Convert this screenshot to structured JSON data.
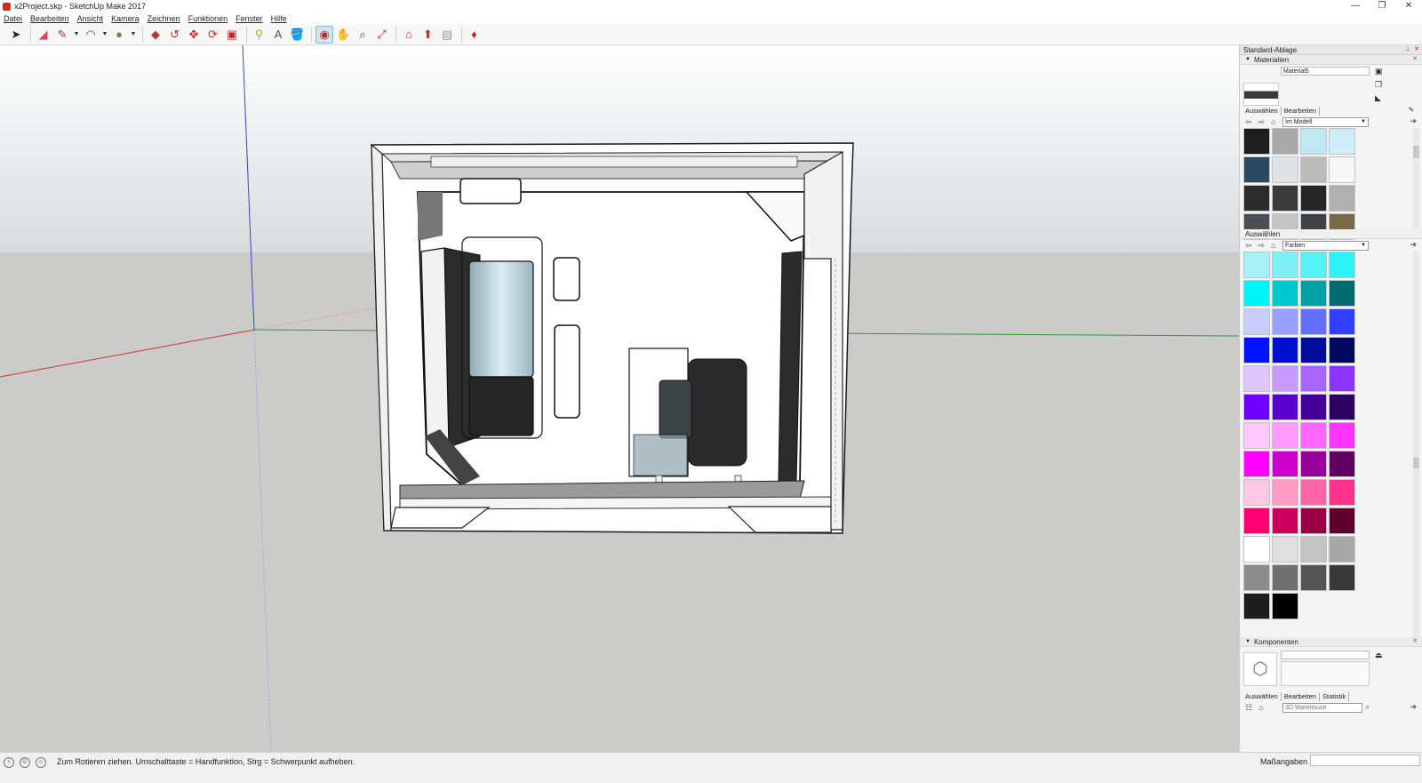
{
  "window": {
    "title": "x2Project.skp - SketchUp Make 2017",
    "controls": [
      "—",
      "❐",
      "✕"
    ]
  },
  "menu": [
    "Datei",
    "Bearbeiten",
    "Ansicht",
    "Kamera",
    "Zeichnen",
    "Funktionen",
    "Fenster",
    "Hilfe"
  ],
  "toolbar": {
    "tools": [
      {
        "name": "select-tool",
        "icon": "➤",
        "color": "#222"
      },
      {
        "name": "eraser-tool",
        "icon": "◢",
        "color": "#d9475a"
      },
      {
        "name": "pencil-tool",
        "icon": "✎",
        "color": "#c62828"
      },
      {
        "name": "arc-tool",
        "icon": "◠",
        "color": "#c62828"
      },
      {
        "name": "shape-tool",
        "icon": "●",
        "color": "#8a7a55"
      },
      {
        "name": "pushpull-tool",
        "icon": "◆",
        "color": "#b23a2a"
      },
      {
        "name": "followme-tool",
        "icon": "↺",
        "color": "#c62828"
      },
      {
        "name": "move-tool",
        "icon": "✥",
        "color": "#c62828"
      },
      {
        "name": "rotate-tool",
        "icon": "⟳",
        "color": "#c62828"
      },
      {
        "name": "scale-tool",
        "icon": "▣",
        "color": "#c62828"
      },
      {
        "name": "tape-tool",
        "icon": "⚲",
        "color": "#c0a020"
      },
      {
        "name": "text-tool",
        "icon": "A",
        "color": "#555"
      },
      {
        "name": "paint-tool",
        "icon": "🪣",
        "color": "#d08020"
      },
      {
        "name": "orbit-tool",
        "icon": "◉",
        "color": "#c62828"
      },
      {
        "name": "pan-tool",
        "icon": "✋",
        "color": "#c0a020"
      },
      {
        "name": "zoom-tool",
        "icon": "⌕",
        "color": "#445"
      },
      {
        "name": "zoom-extents-tool",
        "icon": "⤢",
        "color": "#c62828"
      },
      {
        "name": "warehouse-tool",
        "icon": "⌂",
        "color": "#c62828"
      },
      {
        "name": "share-tool",
        "icon": "⬆",
        "color": "#c62828"
      },
      {
        "name": "extension-tool",
        "icon": "▤",
        "color": "#999"
      },
      {
        "name": "ruby-tool",
        "icon": "♦",
        "color": "#c62828"
      }
    ]
  },
  "panel": {
    "title": "Standard-Ablage",
    "materials": {
      "header": "Materialien",
      "name_value": "Material5",
      "tabs": [
        "Auswählen",
        "Bearbeiten"
      ],
      "collection": "Im Modell",
      "swatches": [
        "#1e1e1e",
        "#a9a9a9",
        "#bfe8f2",
        "#cdeef6",
        "#2a4a62",
        "#dfe3e8",
        "#bcbcbc",
        "#f7f7f7",
        "#2b2b2b",
        "#3a3a3a",
        "#262626",
        "#b0b0b0",
        "#4a4f55",
        "#c4c4c4",
        "#3f4346",
        "#7a6a48"
      ]
    },
    "colors": {
      "header": "Auswählen",
      "collection": "Farben",
      "swatches": [
        "#a8f0f7",
        "#7ef0f6",
        "#55f2f6",
        "#2ef3f7",
        "#00f5f8",
        "#00c8cc",
        "#00a0a4",
        "#006b6d",
        "#c8cbff",
        "#9aa0ff",
        "#6670ff",
        "#3341ff",
        "#0013ff",
        "#0010cc",
        "#000c99",
        "#00085e",
        "#e0c8ff",
        "#c49aff",
        "#a865ff",
        "#8c33ff",
        "#7000ff",
        "#5a00cc",
        "#440099",
        "#2c0060",
        "#ffc8ff",
        "#ff9aff",
        "#ff66ff",
        "#ff33ff",
        "#ff00ff",
        "#cc00cc",
        "#990099",
        "#600060",
        "#ffc8e1",
        "#ff9ac4",
        "#ff66a8",
        "#ff338c",
        "#ff0070",
        "#cc005a",
        "#990044",
        "#60002c",
        "#ffffff",
        "#e0e0e0",
        "#c4c4c4",
        "#a8a8a8",
        "#8c8c8c",
        "#707070",
        "#545454",
        "#383838",
        "#1c1c1c",
        "#000000"
      ]
    },
    "components": {
      "header": "Komponenten",
      "tabs": [
        "Auswählen",
        "Bearbeiten",
        "Statistik"
      ],
      "search_placeholder": "3D Warehouse"
    }
  },
  "status": {
    "hint": "Zum Rotieren ziehen. Umschalttaste = Handfunktion, Strg = Schwerpunkt aufheben.",
    "measure_label": "Maßangaben",
    "measure_value": ""
  }
}
